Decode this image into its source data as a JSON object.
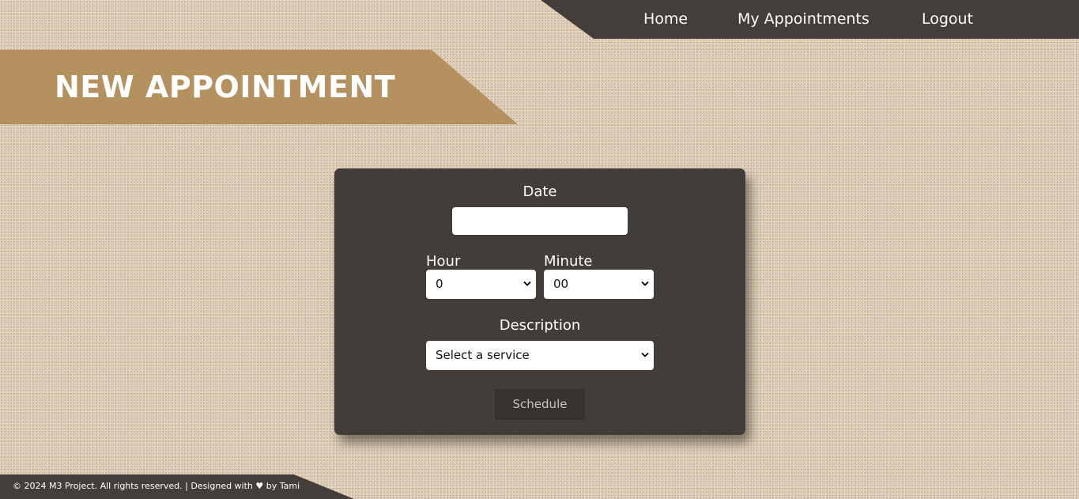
{
  "nav": {
    "items": [
      {
        "label": "Home"
      },
      {
        "label": "My Appointments"
      },
      {
        "label": "Logout"
      }
    ]
  },
  "page": {
    "title": "NEW APPOINTMENT"
  },
  "form": {
    "date_label": "Date",
    "date_value": "",
    "hour_label": "Hour",
    "hour_value": "0",
    "minute_label": "Minute",
    "minute_value": "00",
    "description_label": "Description",
    "description_value": "Select a service",
    "schedule_label": "Schedule"
  },
  "icons": {
    "dropdown": "chevron-down-icon"
  },
  "colors": {
    "nav_background": "#433e39",
    "banner_background": "#b4915f",
    "card_background": "#423d38",
    "button_background": "#353230",
    "page_background": "#e3d2bb"
  },
  "footer": {
    "text": "© 2024 M3 Project. All rights reserved. | Designed with ♥ by Tami"
  }
}
